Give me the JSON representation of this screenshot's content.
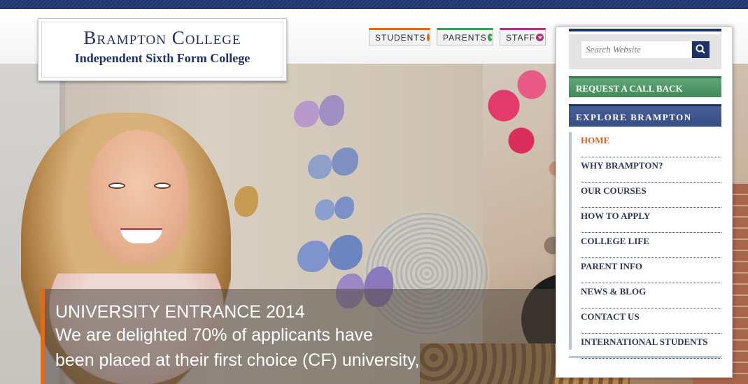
{
  "logo": {
    "name": "Brampton College",
    "subtitle": "Independent Sixth Form College"
  },
  "audience_buttons": [
    {
      "label": "STUDENTS",
      "icon": "chevron-down-icon",
      "color": "#e2681a"
    },
    {
      "label": "PARENTS",
      "icon": "chevron-down-icon",
      "color": "#3f9b59"
    },
    {
      "label": "STAFF",
      "icon": "chevron-down-icon",
      "color": "#b0357f"
    }
  ],
  "search": {
    "placeholder": "Search Website",
    "button_icon": "search-icon"
  },
  "sidebar": {
    "callback_label": "REQUEST A CALL BACK",
    "explore_label": "EXPLORE BRAMPTON",
    "menu": [
      {
        "label": "HOME",
        "active": true
      },
      {
        "label": "WHY BRAMPTON?"
      },
      {
        "label": "OUR COURSES"
      },
      {
        "label": "HOW TO APPLY"
      },
      {
        "label": "COLLEGE LIFE"
      },
      {
        "label": "PARENT INFO"
      },
      {
        "label": "NEWS & BLOG"
      },
      {
        "label": "CONTACT US"
      },
      {
        "label": "INTERNATIONAL STUDENTS"
      }
    ]
  },
  "hero": {
    "caption_title": "UNIVERSITY ENTRANCE 2014",
    "caption_line1": "We are delighted 70% of applicants have",
    "caption_line2": "been placed at their first choice (CF) university,"
  },
  "colors": {
    "navy": "#1e3268",
    "accent_orange": "#e2681a",
    "green": "#3f8b58",
    "menu_text": "#2d3756"
  }
}
